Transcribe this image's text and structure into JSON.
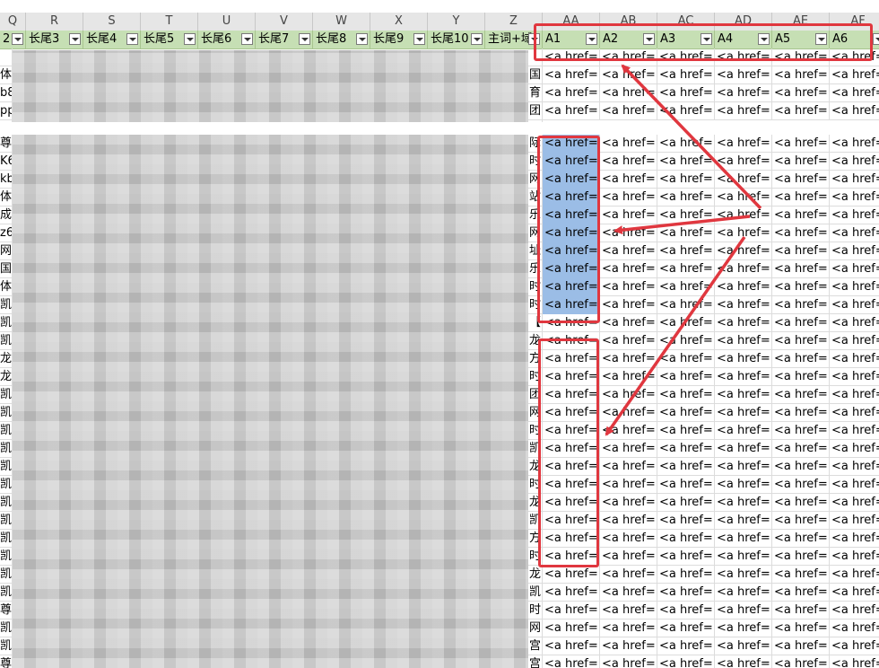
{
  "sheet": {
    "column_letters": [
      "Q",
      "R",
      "S",
      "T",
      "U",
      "V",
      "W",
      "X",
      "Y",
      "Z",
      "AA",
      "AB",
      "AC",
      "AD",
      "AE",
      "AF"
    ],
    "filter_headers": [
      "2",
      "长尾3",
      "长尾4",
      "长尾5",
      "长尾6",
      "长尾7",
      "长尾8",
      "长尾9",
      "长尾10",
      "主词+域",
      "A1",
      "A2",
      "A3",
      "A4",
      "A5",
      "A6"
    ],
    "row1_partial": [
      "...",
      "...",
      "...",
      "...",
      "...",
      "...",
      "...",
      "...",
      "...",
      "...",
      "<a href=\"",
      "<a href=\"",
      "<a href=\"",
      "<a href=\"",
      "<a href=\"",
      "<a href=\""
    ],
    "left_col_chars": [
      "",
      "体",
      "b8",
      "pp",
      "",
      "尊",
      "K6",
      "kb",
      "体",
      "成",
      "z6",
      "网",
      "国",
      "体",
      "凯",
      "凯",
      "凯",
      "龙",
      "龙",
      "凯",
      "凯",
      "凯",
      "凯",
      "凯",
      "凯",
      "凯",
      "凯",
      "凯",
      "凯",
      "凯",
      "凯",
      "尊",
      "凯",
      "凯",
      "尊",
      "站",
      "宫"
    ],
    "z_col_chars": [
      "",
      "国",
      "育",
      "团",
      "",
      "际",
      "时",
      "网",
      "站",
      "乐",
      "网",
      "址",
      "乐",
      "时",
      "时",
      "【",
      "龙",
      "方",
      "时",
      "团",
      "网",
      "时",
      "凯",
      "龙",
      "时",
      "龙",
      "凯",
      "方",
      "时",
      "龙",
      "凯",
      "时",
      "网",
      "宫",
      "宫"
    ],
    "href_snippet": "<a href=\"",
    "href_snippet_full": "<a href=\"h",
    "accent_red": "#e0373f",
    "header_green": "#c6dfb4",
    "selection_blue": "#9bbde6"
  }
}
